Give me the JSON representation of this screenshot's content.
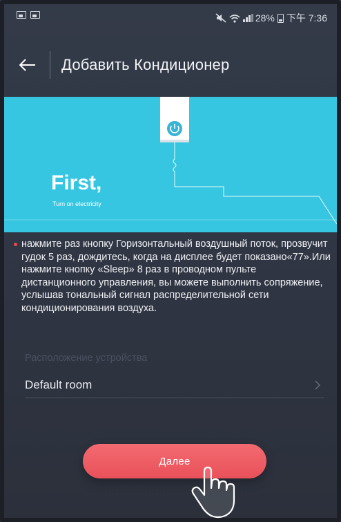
{
  "status_bar": {
    "battery": "28%",
    "time": "下午 7:36",
    "icons": [
      "image-icon",
      "image-icon",
      "mute-icon",
      "wifi-icon",
      "signal-icon",
      "battery-icon"
    ]
  },
  "header": {
    "back_icon": "arrow-left-icon",
    "title": "Добавить Кондиционер"
  },
  "illustration": {
    "heading": "First,",
    "subheading": "Turn on electricity",
    "colors": {
      "background": "#37c6e1",
      "socket": "#ffffff",
      "power_button": "#39b3d6"
    }
  },
  "instruction": {
    "text": "нажмите раз кнопку Горизонтальный воздушный поток, прозвучит гудок 5 раз, дождитесь, когда на дисплее будет показано«77».Или нажмите кнопку «Sleep» 8 раз в проводном пульте дистанционного управления, вы можете выполнить сопряжение, услышав тональный сигнал распределительной сети кондиционирования воздуха.",
    "bullet_color": "#ee4a54"
  },
  "location": {
    "label": "Расположение устройства",
    "selected_room": "Default room"
  },
  "next_button": {
    "label": "Далее",
    "color": "#ee5a62"
  }
}
